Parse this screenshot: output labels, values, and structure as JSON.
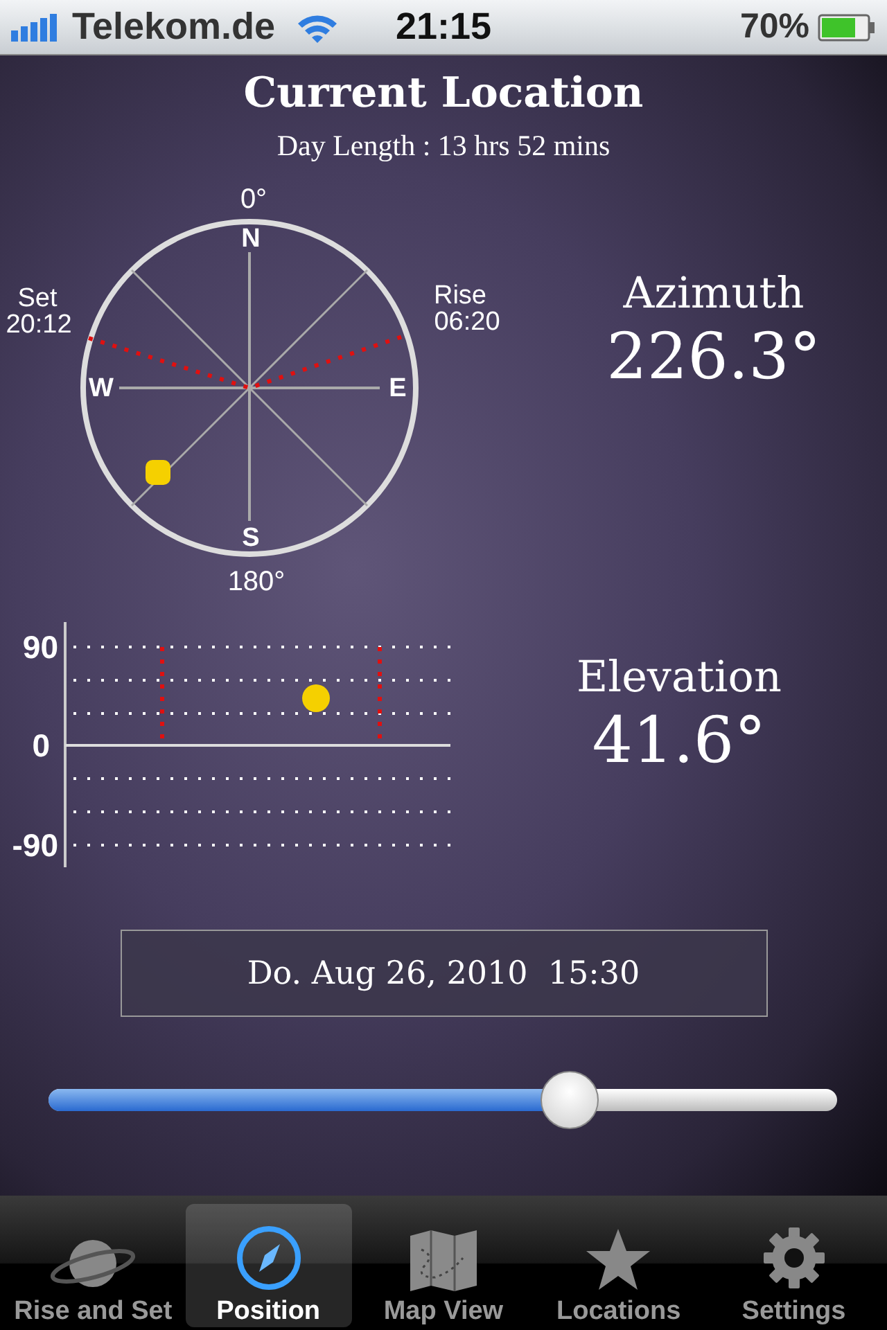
{
  "status_bar": {
    "carrier": "Telekom.de",
    "time": "21:15",
    "battery": "70%"
  },
  "title": "Current Location",
  "day_length": "Day Length :  13 hrs 52 mins",
  "compass": {
    "top": "0°",
    "bottom": "180°",
    "north": "N",
    "south": "S",
    "west": "W",
    "east": "E",
    "set_label": "Set",
    "set_time": "20:12",
    "rise_label": "Rise",
    "rise_time": "06:20"
  },
  "azimuth": {
    "label": "Azimuth",
    "value": "226.3°"
  },
  "elevation_chart": {
    "ticks": [
      "90",
      "0",
      "-90"
    ]
  },
  "elevation": {
    "label": "Elevation",
    "value": "41.6°"
  },
  "date_button": "Do. Aug 26, 2010  15:30",
  "time_slider": {
    "level": 0.66
  },
  "tabs": [
    {
      "label": "Rise and Set",
      "kind": "planet",
      "selected": false
    },
    {
      "label": "Position",
      "kind": "compass",
      "selected": true
    },
    {
      "label": "Map View",
      "kind": "map",
      "selected": false
    },
    {
      "label": "Locations",
      "kind": "star",
      "selected": false
    },
    {
      "label": "Settings",
      "kind": "gear",
      "selected": false
    }
  ]
}
